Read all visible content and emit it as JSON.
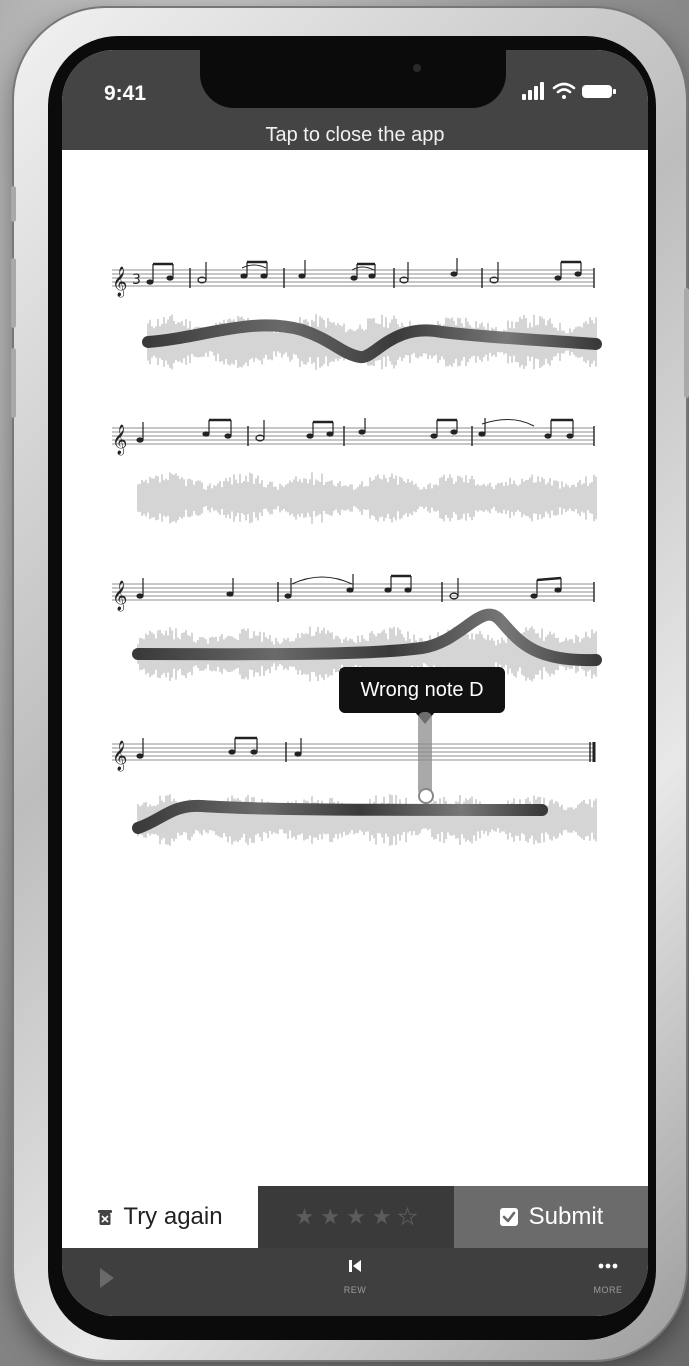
{
  "status_bar": {
    "time": "9:41",
    "close_hint": "Tap to close the app",
    "icons": [
      "signal-icon",
      "wifi-icon",
      "battery-icon"
    ]
  },
  "score": {
    "staff_count": 4,
    "error_tooltip": "Wrong note D"
  },
  "action_bar": {
    "try_again_label": "Try again",
    "try_again_icon": "trash-icon",
    "rating": {
      "filled": 4,
      "max": 5
    },
    "submit_label": "Submit",
    "submit_icon": "clipboard-check-icon"
  },
  "toolbar": {
    "play_icon": "play-icon",
    "rew_label": "REW",
    "rew_icon": "skip-back-icon",
    "more_label": "MORE",
    "more_icon": "more-icon"
  },
  "colors": {
    "status_bg": "#444444",
    "sheet_bg": "#ffffff",
    "pitch_line": "#4a4a4a",
    "waveform": "#b9b9b9",
    "tooltip_bg": "#111111",
    "submit_bg": "#6b6b6b",
    "rating_bg": "#3a3a3a",
    "toolbar_bg": "#3f3f3f"
  }
}
